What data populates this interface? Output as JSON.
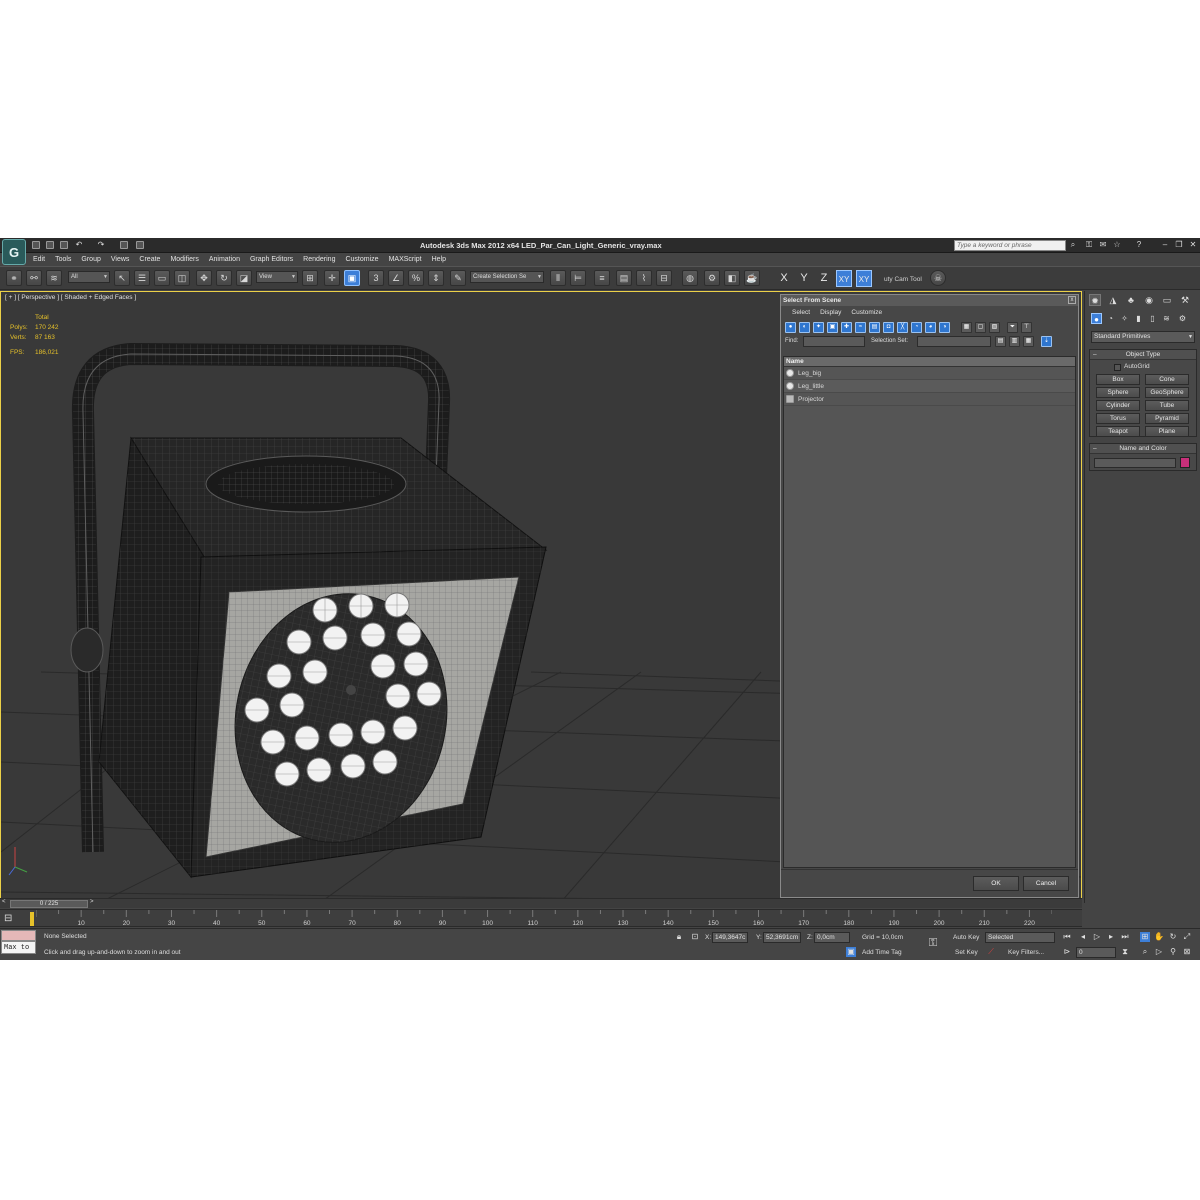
{
  "window": {
    "title": "Autodesk 3ds Max  2012 x64     LED_Par_Can_Light_Generic_vray.max",
    "search_placeholder": "Type a keyword or phrase",
    "logo_letter": "G"
  },
  "menu": [
    "Edit",
    "Tools",
    "Group",
    "Views",
    "Create",
    "Modifiers",
    "Animation",
    "Graph Editors",
    "Rendering",
    "Customize",
    "MAXScript",
    "Help"
  ],
  "toolbar": {
    "filter_value": "All",
    "coord_value": "View",
    "selection_set_value": "Create Selection Se",
    "axis_x": "X",
    "axis_y": "Y",
    "axis_z": "Z",
    "axis_xy": "XY",
    "axis_xy2": "XY",
    "tool_label": "uty Cam Tool"
  },
  "viewport": {
    "label": "[ + ] [ Perspective ] [ Shaded + Edged Faces ]",
    "stats": {
      "total_label": "Total",
      "polys_label": "Polys:",
      "polys_value": "170 242",
      "verts_label": "Verts:",
      "verts_value": "87 163",
      "fps_label": "FPS:",
      "fps_value": "186,021"
    }
  },
  "select_from_scene": {
    "title": "Select From Scene",
    "close": "x",
    "menu": [
      "Select",
      "Display",
      "Customize"
    ],
    "find_label": "Find:",
    "selection_set_label": "Selection Set:",
    "column_name": "Name",
    "items": [
      {
        "name": "Leg_big",
        "icon": "sphere-icon"
      },
      {
        "name": "Leg_little",
        "icon": "sphere-icon"
      },
      {
        "name": "Projector",
        "icon": "camera-icon"
      }
    ],
    "ok_label": "OK",
    "cancel_label": "Cancel"
  },
  "command_panel": {
    "dropdown": "Standard Primitives",
    "object_type_title": "Object Type",
    "autogrid_label": "AutoGrid",
    "buttons": [
      "Box",
      "Cone",
      "Sphere",
      "GeoSphere",
      "Cylinder",
      "Tube",
      "Torus",
      "Pyramid",
      "Teapot",
      "Plane"
    ],
    "name_color_title": "Name and Color",
    "swatch_color": "#c8307a"
  },
  "timeline": {
    "frame_display": "0 / 225",
    "ticks": [
      "10",
      "20",
      "30",
      "40",
      "50",
      "60",
      "70",
      "80",
      "90",
      "100",
      "110",
      "120",
      "130",
      "140",
      "150",
      "160",
      "170",
      "180",
      "190",
      "200",
      "210",
      "220"
    ],
    "prev_label": "<",
    "next_label": ">"
  },
  "status": {
    "maxscript_text": "Max to",
    "selection_text": "None Selected",
    "prompt_text": "Click and drag up-and-down to zoom in and out",
    "x_label": "X:",
    "x_value": "149,3647c",
    "y_label": "Y:",
    "y_value": "52,3691cm",
    "z_label": "Z:",
    "z_value": "0,0cm",
    "grid_text": "Grid = 10,0cm",
    "add_time_tag": "Add Time Tag",
    "auto_key": "Auto Key",
    "set_key": "Set Key",
    "selected_value": "Selected",
    "key_filters": "Key Filters...",
    "frame_value": "0"
  },
  "colors": {
    "accent": "#3d7fd8",
    "viewport_border": "#ecd148",
    "stats_text": "#e6c12a"
  }
}
